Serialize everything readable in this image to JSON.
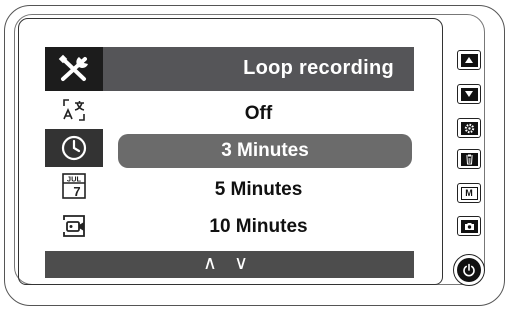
{
  "menu": {
    "title": "Loop recording",
    "options": [
      "Off",
      "3 Minutes",
      "5 Minutes",
      "10 Minutes"
    ],
    "selected_index": 1,
    "nav_hint": "∧ ∨"
  },
  "sidebar": {
    "icons": [
      "settings-tools-icon",
      "language-icon",
      "clock-icon",
      "date-calendar-icon",
      "video-mode-icon"
    ],
    "active": "settings-tools-icon",
    "highlighted": "clock-icon",
    "calendar_text": "JUL",
    "calendar_day": "7"
  },
  "hardware_buttons": [
    "up-button",
    "down-button",
    "settings-button",
    "delete-button",
    "mode-button",
    "camera-button",
    "power-button"
  ],
  "mode_label": "M",
  "colors": {
    "title_bar": "#555558",
    "selected_row": "#6b6b6b",
    "bottom_bar": "#4d4d4d"
  }
}
